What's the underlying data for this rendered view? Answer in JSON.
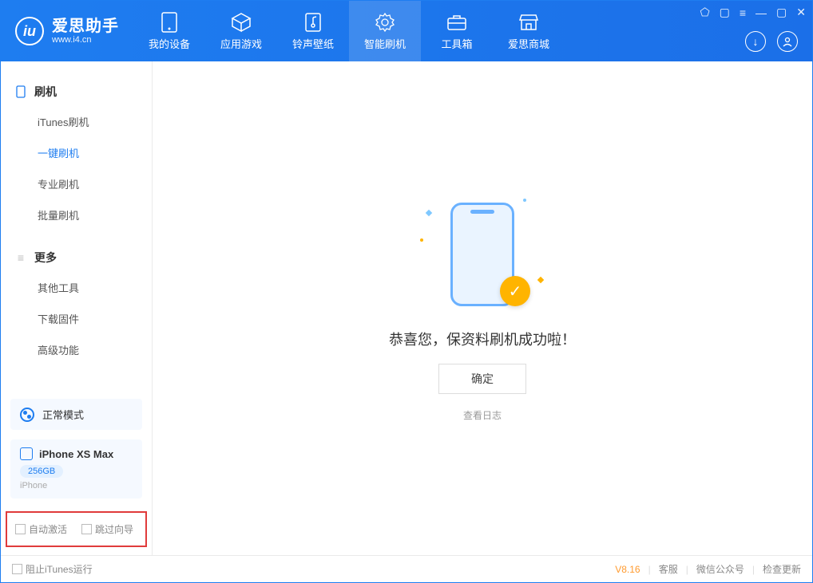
{
  "app": {
    "title": "爱思助手",
    "subtitle": "www.i4.cn"
  },
  "nav": {
    "tabs": [
      {
        "label": "我的设备",
        "icon": "device-icon"
      },
      {
        "label": "应用游戏",
        "icon": "cube-icon"
      },
      {
        "label": "铃声壁纸",
        "icon": "music-icon"
      },
      {
        "label": "智能刷机",
        "icon": "gear-icon",
        "active": true
      },
      {
        "label": "工具箱",
        "icon": "briefcase-icon"
      },
      {
        "label": "爱思商城",
        "icon": "store-icon"
      }
    ]
  },
  "sidebar": {
    "group1": {
      "title": "刷机",
      "items": [
        {
          "label": "iTunes刷机"
        },
        {
          "label": "一键刷机",
          "active": true
        },
        {
          "label": "专业刷机"
        },
        {
          "label": "批量刷机"
        }
      ]
    },
    "group2": {
      "title": "更多",
      "items": [
        {
          "label": "其他工具"
        },
        {
          "label": "下载固件"
        },
        {
          "label": "高级功能"
        }
      ]
    },
    "mode": {
      "label": "正常模式"
    },
    "device": {
      "name": "iPhone XS Max",
      "storage": "256GB",
      "type": "iPhone"
    },
    "checkboxes": {
      "autoActivate": "自动激活",
      "skipGuide": "跳过向导"
    }
  },
  "main": {
    "successTitle": "恭喜您，保资料刷机成功啦！",
    "ok": "确定",
    "viewLog": "查看日志"
  },
  "footer": {
    "blockItunes": "阻止iTunes运行",
    "version": "V8.16",
    "links": {
      "service": "客服",
      "wechat": "微信公众号",
      "update": "检查更新"
    }
  }
}
